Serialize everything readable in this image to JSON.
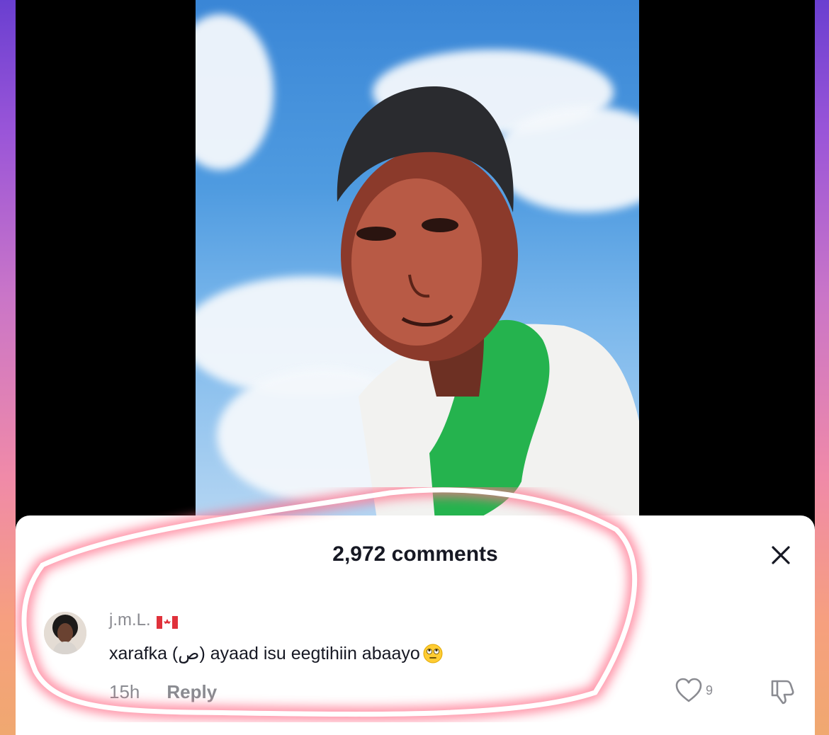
{
  "comments_sheet": {
    "title": "2,972 comments",
    "close_icon": "close-icon"
  },
  "comment": {
    "username": "j.m.L.",
    "flag_icon": "canada-flag-icon",
    "text": "xarafka (ص) ayaad isu eegtihiin abaayo",
    "emoji_icon": "rolling-eyes-emoji-icon",
    "time": "15h",
    "reply_label": "Reply",
    "like_count": "9",
    "like_icon": "heart-icon",
    "dislike_icon": "thumbs-down-icon"
  },
  "colors": {
    "highlight_stroke": "#ff6f8a",
    "text_primary": "#161823",
    "text_secondary": "#8a8b91"
  }
}
